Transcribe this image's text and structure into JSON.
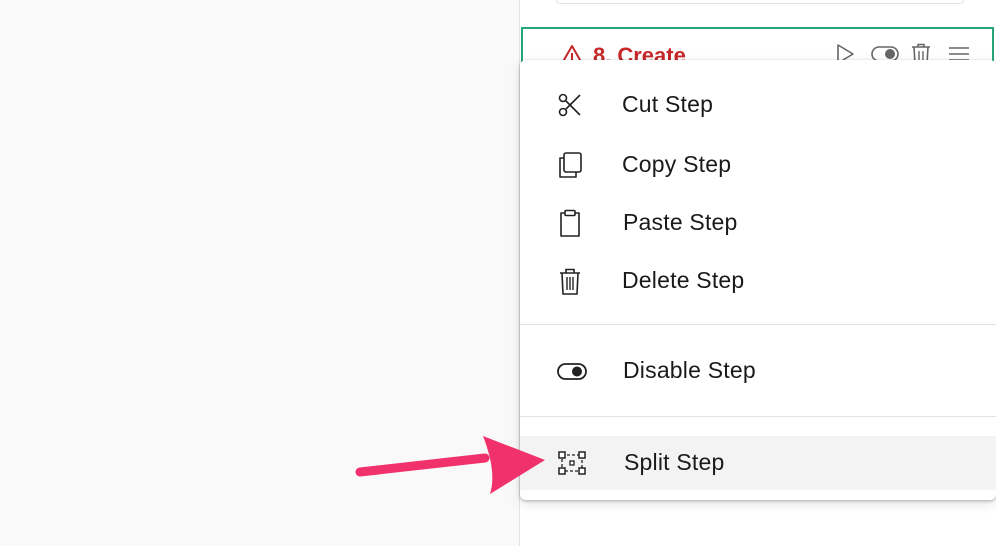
{
  "step": {
    "number": "8.",
    "title": "Create",
    "warning_icon": "warning-triangle-icon",
    "tools": [
      "play-icon",
      "toggle-icon",
      "trash-icon",
      "menu-icon"
    ]
  },
  "context_menu": {
    "items": [
      {
        "label": "Cut Step",
        "icon": "scissors-icon"
      },
      {
        "label": "Copy Step",
        "icon": "copy-icon"
      },
      {
        "label": "Paste Step",
        "icon": "clipboard-icon"
      },
      {
        "label": "Delete Step",
        "icon": "trash-icon"
      },
      {
        "label": "Disable Step",
        "icon": "toggle-icon"
      },
      {
        "label": "Split Step",
        "icon": "split-icon"
      }
    ]
  },
  "colors": {
    "step_border": "#27a57a",
    "error_red": "#c62828",
    "arrow_pink": "#f0316b"
  }
}
